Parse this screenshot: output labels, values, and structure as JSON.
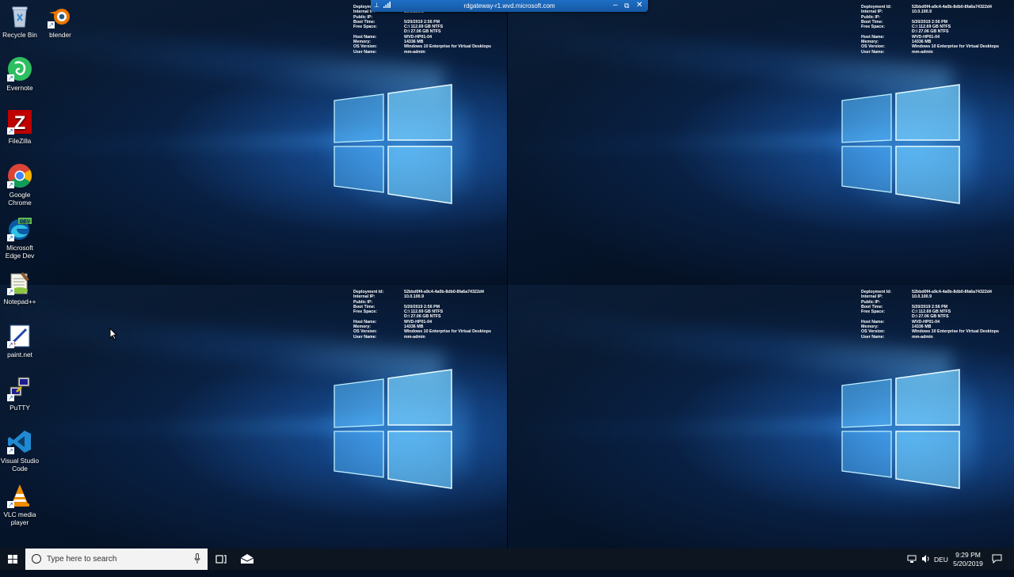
{
  "rdp_bar": {
    "title": "rdgateway-r1.wvd.microsoft.com",
    "pin_icon": "pin-icon",
    "signal_icon": "connection-signal-icon",
    "minimize": "–",
    "restore": "⧉",
    "close": "✕"
  },
  "desktop_icons": [
    {
      "label": "Recycle Bin",
      "icon": "recycle-bin-icon"
    },
    {
      "label": "blender",
      "icon": "blender-icon"
    },
    {
      "label": "Evernote",
      "icon": "evernote-icon"
    },
    {
      "label": "FileZilla",
      "icon": "filezilla-icon"
    },
    {
      "label": "Google Chrome",
      "icon": "chrome-icon"
    },
    {
      "label": "Microsoft Edge Dev",
      "icon": "edge-dev-icon"
    },
    {
      "label": "Notepad++",
      "icon": "notepad-plus-plus-icon"
    },
    {
      "label": "paint.net",
      "icon": "paint-net-icon"
    },
    {
      "label": "PuTTY",
      "icon": "putty-icon"
    },
    {
      "label": "Visual Studio Code",
      "icon": "vscode-icon"
    },
    {
      "label": "VLC media player",
      "icon": "vlc-icon"
    }
  ],
  "sysinfo": {
    "deployment_id_label": "Deployment Id:",
    "deployment_id": "52bbd0f4-a9c4-4a0b-8db0-8fa6a74322d4",
    "internal_ip_label": "Internal IP:",
    "internal_ip": "10.0.100.9",
    "public_ip_label": "Public IP:",
    "public_ip": "",
    "boot_time_label": "Boot Time:",
    "boot_time": "5/20/2019 2:56 PM",
    "free_space_label": "Free Space:",
    "free_space_c": "C:\\ 112.69 GB NTFS",
    "free_space_d": "D:\\ 27.06 GB NTFS",
    "host_name_label": "Host Name:",
    "host_name": "WVD-HP01-04",
    "memory_label": "Memory:",
    "memory": "14336 MB",
    "os_version_label": "OS Version:",
    "os_version": "Windows 10 Enterprise for Virtual Desktops",
    "user_name_label": "User Name:",
    "user_name": "mm-admin"
  },
  "taskbar": {
    "search_placeholder": "Type here to search",
    "language": "DEU",
    "time": "9:29 PM",
    "date": "5/20/2019"
  }
}
